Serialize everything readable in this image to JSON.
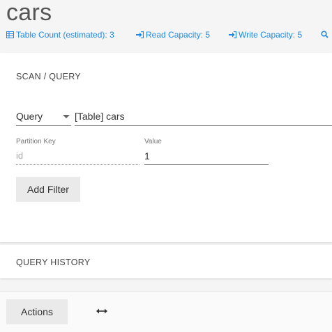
{
  "header": {
    "title": "cars",
    "stats": [
      {
        "icon": "table-icon",
        "label": "Table Count (estimated): 3"
      },
      {
        "icon": "sign-in-icon",
        "label": "Read Capacity: 5"
      },
      {
        "icon": "sign-in-icon",
        "label": "Write Capacity: 5"
      },
      {
        "icon": "search-icon",
        "label": ""
      }
    ]
  },
  "scan": {
    "title": "SCAN / QUERY",
    "mode": "Query",
    "table": "[Table] cars",
    "partition_key_label": "Partition Key",
    "partition_key_value": "id",
    "value_label": "Value",
    "value": "1",
    "add_filter_label": "Add Filter"
  },
  "history": {
    "title": "QUERY HISTORY"
  },
  "footer": {
    "actions_label": "Actions",
    "resize_icon": "arrows-horizontal-icon"
  },
  "colors": {
    "accent": "#1e88e5",
    "background": "#f5f5f5",
    "card": "#ffffff"
  }
}
